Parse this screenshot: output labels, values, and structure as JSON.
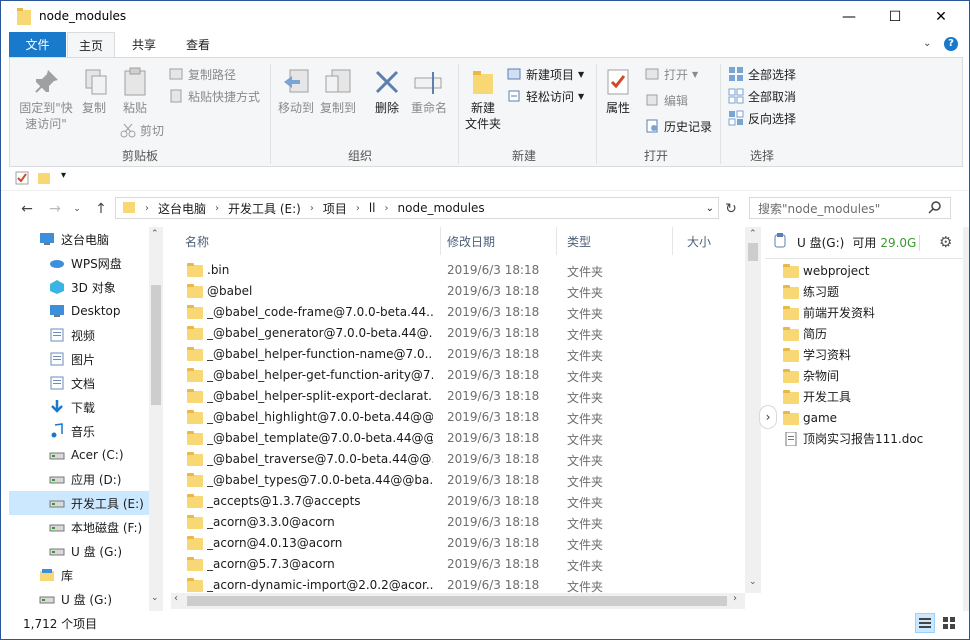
{
  "window": {
    "title": "node_modules",
    "minimize": "—",
    "maximize": "☐",
    "close": "✕"
  },
  "ribbon_tabs": {
    "file": "文件",
    "home": "主页",
    "share": "共享",
    "view": "查看"
  },
  "ribbon": {
    "clipboard": {
      "label": "剪贴板",
      "pin_quick_access": "固定到\"快速访问\"",
      "copy": "复制",
      "paste": "粘贴",
      "copy_path": "复制路径",
      "paste_shortcut": "粘贴快捷方式",
      "cut": "剪切"
    },
    "organize": {
      "label": "组织",
      "move_to": "移动到",
      "copy_to": "复制到",
      "delete": "删除",
      "rename": "重命名"
    },
    "new": {
      "label": "新建",
      "new_folder": "新建\n文件夹",
      "new_item": "新建项目",
      "easy_access": "轻松访问"
    },
    "open": {
      "label": "打开",
      "properties": "属性",
      "open": "打开",
      "edit": "编辑",
      "history": "历史记录"
    },
    "select": {
      "label": "选择",
      "select_all": "全部选择",
      "select_none": "全部取消",
      "invert": "反向选择"
    }
  },
  "breadcrumb": [
    "这台电脑",
    "开发工具 (E:)",
    "项目",
    "ll",
    "node_modules"
  ],
  "search_placeholder": "搜索\"node_modules\"",
  "nav_pane": [
    {
      "label": "这台电脑",
      "icon": "computer-icon"
    },
    {
      "label": "WPS网盘",
      "icon": "cloud-icon"
    },
    {
      "label": "3D 对象",
      "icon": "cube-icon"
    },
    {
      "label": "Desktop",
      "icon": "desktop-icon"
    },
    {
      "label": "视频",
      "icon": "video-icon"
    },
    {
      "label": "图片",
      "icon": "picture-icon"
    },
    {
      "label": "文档",
      "icon": "document-icon"
    },
    {
      "label": "下载",
      "icon": "download-icon"
    },
    {
      "label": "音乐",
      "icon": "music-icon"
    },
    {
      "label": "Acer (C:)",
      "icon": "drive-icon"
    },
    {
      "label": "应用 (D:)",
      "icon": "drive-icon"
    },
    {
      "label": "开发工具 (E:)",
      "icon": "drive-icon"
    },
    {
      "label": "本地磁盘 (F:)",
      "icon": "drive-icon"
    },
    {
      "label": "U 盘 (G:)",
      "icon": "usb-drive-icon"
    },
    {
      "label": "库",
      "icon": "library-icon"
    },
    {
      "label": "U 盘 (G:)",
      "icon": "usb-drive-icon"
    }
  ],
  "columns": {
    "name": "名称",
    "date": "修改日期",
    "type": "类型",
    "size": "大小"
  },
  "files": [
    {
      "name": ".bin",
      "date": "2019/6/3 18:18",
      "type": "文件夹"
    },
    {
      "name": "@babel",
      "date": "2019/6/3 18:18",
      "type": "文件夹"
    },
    {
      "name": "_@babel_code-frame@7.0.0-beta.44...",
      "date": "2019/6/3 18:18",
      "type": "文件夹"
    },
    {
      "name": "_@babel_generator@7.0.0-beta.44@...",
      "date": "2019/6/3 18:18",
      "type": "文件夹"
    },
    {
      "name": "_@babel_helper-function-name@7.0....",
      "date": "2019/6/3 18:18",
      "type": "文件夹"
    },
    {
      "name": "_@babel_helper-get-function-arity@7...",
      "date": "2019/6/3 18:18",
      "type": "文件夹"
    },
    {
      "name": "_@babel_helper-split-export-declarat...",
      "date": "2019/6/3 18:18",
      "type": "文件夹"
    },
    {
      "name": "_@babel_highlight@7.0.0-beta.44@@...",
      "date": "2019/6/3 18:18",
      "type": "文件夹"
    },
    {
      "name": "_@babel_template@7.0.0-beta.44@@...",
      "date": "2019/6/3 18:18",
      "type": "文件夹"
    },
    {
      "name": "_@babel_traverse@7.0.0-beta.44@@...",
      "date": "2019/6/3 18:18",
      "type": "文件夹"
    },
    {
      "name": "_@babel_types@7.0.0-beta.44@@ba...",
      "date": "2019/6/3 18:18",
      "type": "文件夹"
    },
    {
      "name": "_accepts@1.3.7@accepts",
      "date": "2019/6/3 18:18",
      "type": "文件夹"
    },
    {
      "name": "_acorn@3.3.0@acorn",
      "date": "2019/6/3 18:18",
      "type": "文件夹"
    },
    {
      "name": "_acorn@4.0.13@acorn",
      "date": "2019/6/3 18:18",
      "type": "文件夹"
    },
    {
      "name": "_acorn@5.7.3@acorn",
      "date": "2019/6/3 18:18",
      "type": "文件夹"
    },
    {
      "name": "_acorn-dynamic-import@2.0.2@acor...",
      "date": "2019/6/3 18:18",
      "type": "文件夹"
    }
  ],
  "right_pane": {
    "drive_label": "U 盘(G:)",
    "free_label": "可用",
    "free_value": "29.0G",
    "items": [
      {
        "name": "webproject",
        "kind": "folder"
      },
      {
        "name": "练习题",
        "kind": "folder"
      },
      {
        "name": "前端开发资料",
        "kind": "folder"
      },
      {
        "name": "简历",
        "kind": "folder"
      },
      {
        "name": "学习资料",
        "kind": "folder"
      },
      {
        "name": "杂物间",
        "kind": "folder"
      },
      {
        "name": "开发工具",
        "kind": "folder"
      },
      {
        "name": "game",
        "kind": "folder"
      },
      {
        "name": "顶岗实习报告111.doc",
        "kind": "doc"
      }
    ]
  },
  "status": {
    "item_count": "1,712 个项目"
  },
  "colors": {
    "accent": "#1979ca",
    "folder": "#f8d775",
    "selection": "#cce8ff",
    "free_space": "#3a9a2f"
  }
}
